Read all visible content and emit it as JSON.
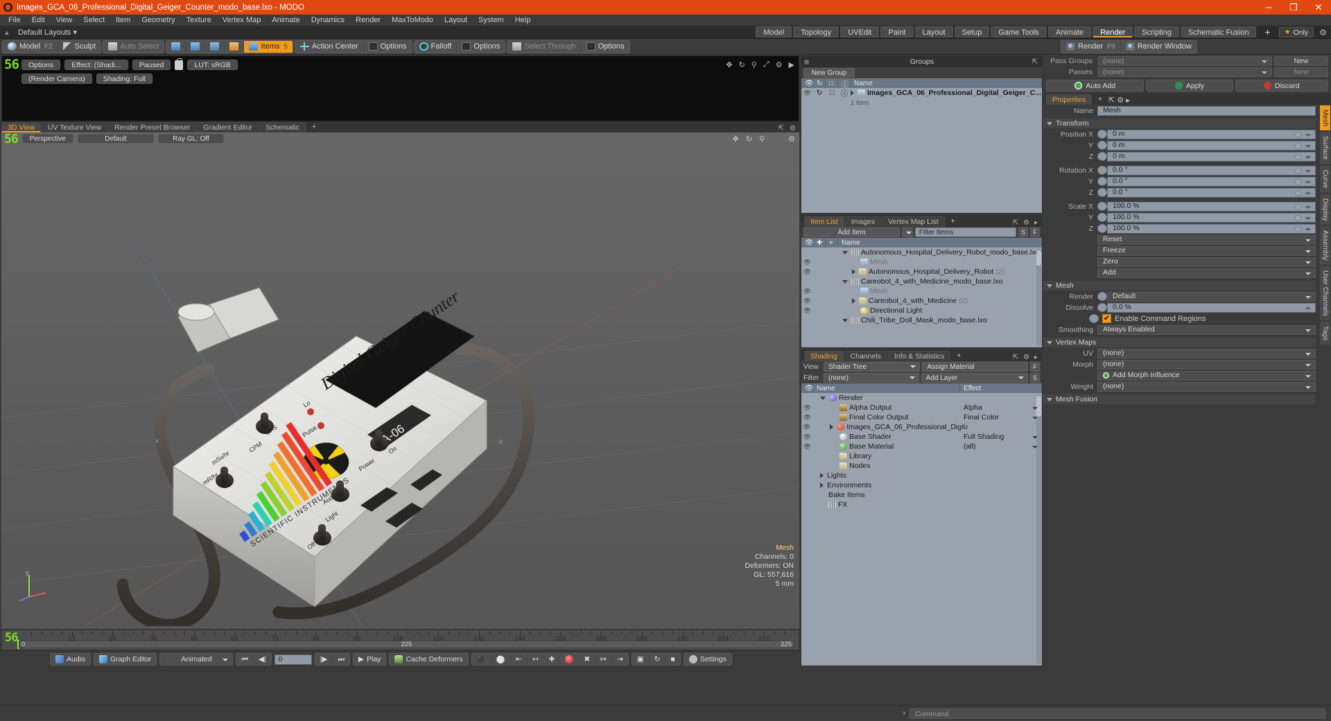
{
  "window": {
    "title": "Images_GCA_06_Professional_Digital_Geiger_Counter_modo_base.lxo - MODO",
    "minimize": "─",
    "maximize": "❐",
    "close": "✕"
  },
  "menu": [
    "File",
    "Edit",
    "View",
    "Select",
    "Item",
    "Geometry",
    "Texture",
    "Vertex Map",
    "Animate",
    "Dynamics",
    "Render",
    "MaxToModo",
    "Layout",
    "System",
    "Help"
  ],
  "layout_bar": {
    "default_layouts": "Default Layouts",
    "tabs": [
      "Model",
      "Topology",
      "UVEdit",
      "Paint",
      "Layout",
      "Setup",
      "Game Tools",
      "Animate",
      "Render",
      "Scripting",
      "Schematic Fusion"
    ],
    "active_tab": "Render",
    "add_tab": "+",
    "only_label": "Only"
  },
  "toolbar": {
    "group1": [
      {
        "label": "Model",
        "kb": "F2",
        "icon": "sphere-icon"
      },
      {
        "label": "Sculpt",
        "kb": "",
        "icon": "pencil-icon"
      }
    ],
    "group2": [
      {
        "label": "Auto Select",
        "kb": "",
        "icon": "cube-gray-icon",
        "dim": true
      }
    ],
    "group3": [
      {
        "label": "",
        "kb": "",
        "icon": "vertex-mode-icon"
      },
      {
        "label": "",
        "kb": "",
        "icon": "edge-mode-icon"
      },
      {
        "label": "",
        "kb": "",
        "icon": "polygon-mode-icon"
      },
      {
        "label": "",
        "kb": "",
        "icon": "material-mode-icon"
      },
      {
        "label": "Items",
        "kb": "5",
        "icon": "items-mode-icon",
        "active": true
      }
    ],
    "group4": [
      {
        "label": "Action Center",
        "kb": "",
        "icon": "action-center-icon"
      },
      {
        "label": "Options",
        "kb": "",
        "icon": "options-square-icon"
      }
    ],
    "group5": [
      {
        "label": "Falloff",
        "kb": "",
        "icon": "falloff-icon"
      },
      {
        "label": "Options",
        "kb": "",
        "icon": "options-square-icon"
      }
    ],
    "group6": [
      {
        "label": "Select Through",
        "kb": "",
        "icon": "select-through-icon",
        "dim": true
      },
      {
        "label": "Options",
        "kb": "",
        "icon": "options-square-icon"
      }
    ],
    "group7": [
      {
        "label": "Render",
        "kb": "F9",
        "icon": "render-icon"
      },
      {
        "label": "Render Window",
        "kb": "",
        "icon": "render-window-icon"
      }
    ]
  },
  "preview": {
    "badge": "56",
    "options": "Options",
    "effect": "Effect: (Shadi...",
    "paused": "Paused",
    "lut": "LUT: sRGB",
    "camera": "(Render Camera)",
    "shading": "Shading: Full",
    "icons": [
      "move-icon",
      "rotate-icon",
      "zoom-icon",
      "fit-icon",
      "gear-icon",
      "play-icon"
    ]
  },
  "viewport": {
    "tabs": [
      "3D View",
      "UV Texture View",
      "Render Preset Browser",
      "Gradient Editor",
      "Schematic"
    ],
    "active_tab": "3D View",
    "add_tab": "+",
    "badge": "56",
    "perspective": "Perspective",
    "shading_style": "Default",
    "raygl": "Ray GL: Off",
    "stats": {
      "title": "Mesh",
      "channels_label": "Channels:",
      "channels": "0",
      "deformers_label": "Deformers:",
      "deformers": "ON",
      "gl_label": "GL:",
      "gl": "557,616",
      "scale": "5 mm"
    },
    "axis_labels": {
      "x": "x",
      "y": "y",
      "z": "-z"
    },
    "device": {
      "title": "Digital Geiger Counter",
      "model": "A-06",
      "brand": "SCIENTIFIC INSTRUMENTS",
      "labels": [
        "Lo",
        "CPS",
        "Pulse",
        "CPM",
        "mSv/hr",
        "mR/hr",
        "Power",
        "On",
        "Audio",
        "Light",
        "Off"
      ]
    }
  },
  "timeline": {
    "badge": "56",
    "ticks": [
      12,
      24,
      36,
      48,
      60,
      72,
      84,
      96,
      108,
      120,
      132,
      144,
      156,
      168,
      180,
      192,
      204,
      216
    ],
    "start": "0",
    "mid": "225",
    "end": "225"
  },
  "bottombar": {
    "audio": "Audio",
    "graph_editor": "Graph Editor",
    "animated": "Animated",
    "frame_value": "0",
    "play": "Play",
    "cache_deformers": "Cache Deformers",
    "settings": "Settings"
  },
  "groups_panel": {
    "title": "Groups",
    "new_group": "New Group",
    "col_name": "Name",
    "item": {
      "name": "Images_GCA_06_Professional_Digital_Geiger_C...",
      "sub": "1 Item"
    }
  },
  "item_list": {
    "tabs": [
      "Item List",
      "Images",
      "Vertex Map List"
    ],
    "active_tab": "Item List",
    "add_tab": "+",
    "add_item": "Add Item",
    "filter_placeholder": "Filter Items",
    "btn_s": "S",
    "btn_f": "F",
    "col_name": "Name",
    "rows": [
      {
        "indent": 0,
        "twirl": "down",
        "icon": "film-icon",
        "name": "Autonomous_Hospital_Delivery_Robot_modo_base.lxo*",
        "eye": false,
        "dim": false
      },
      {
        "indent": 1,
        "twirl": "none",
        "icon": "cube-icon",
        "name": "Mesh",
        "eye": true,
        "dim": true
      },
      {
        "indent": 1,
        "twirl": "right",
        "icon": "folder-icon",
        "name": "Autonomous_Hospital_Delivery_Robot",
        "count": "(2)",
        "eye": true,
        "dim": false
      },
      {
        "indent": 0,
        "twirl": "down",
        "icon": "film-icon",
        "name": "Careobot_4_with_Medicine_modo_base.lxo",
        "eye": false,
        "dim": false
      },
      {
        "indent": 1,
        "twirl": "none",
        "icon": "cube-icon",
        "name": "Mesh",
        "eye": true,
        "dim": true
      },
      {
        "indent": 1,
        "twirl": "right",
        "icon": "folder-icon",
        "name": "Careobot_4_with_Medicine",
        "count": "(2)",
        "eye": true,
        "dim": false
      },
      {
        "indent": 1,
        "twirl": "none",
        "icon": "light-icon",
        "name": "Directional Light",
        "eye": true,
        "dim": false
      },
      {
        "indent": 0,
        "twirl": "down",
        "icon": "film-icon",
        "name": "Chili_Tribe_Doll_Mask_modo_base.lxo",
        "eye": false,
        "dim": false
      }
    ]
  },
  "shading_panel": {
    "tabs": [
      "Shading",
      "Channels",
      "Info & Statistics"
    ],
    "active_tab": "Shading",
    "add_tab": "+",
    "view_label": "View",
    "view_value": "Shader Tree",
    "assign_material": "Assign Material",
    "btn_f": "F",
    "filter_label": "Filter",
    "filter_value": "(none)",
    "add_layer": "Add Layer",
    "btn_s": "S",
    "col_name": "Name",
    "col_effect": "Effect",
    "rows": [
      {
        "indent": 0,
        "twirl": "down",
        "icon": "ball-purple-icon",
        "name": "Render",
        "effect": "",
        "eye": false
      },
      {
        "indent": 1,
        "twirl": "none",
        "icon": "image-icon",
        "name": "Alpha Output",
        "effect": "Alpha",
        "eye": true
      },
      {
        "indent": 1,
        "twirl": "none",
        "icon": "image-icon",
        "name": "Final Color Output",
        "effect": "Final Color",
        "eye": true
      },
      {
        "indent": 1,
        "twirl": "right",
        "icon": "ball-red-icon",
        "name": "Images_GCA_06_Professional_Digital_ ...",
        "effect": "",
        "eye": true
      },
      {
        "indent": 1,
        "twirl": "none",
        "icon": "ball-white-icon",
        "name": "Base Shader",
        "effect": "Full Shading",
        "eye": true
      },
      {
        "indent": 1,
        "twirl": "none",
        "icon": "ball-green-icon",
        "name": "Base Material",
        "effect": "(all)",
        "eye": true
      },
      {
        "indent": 1,
        "twirl": "none",
        "icon": "folder-icon",
        "name": "Library",
        "effect": "",
        "eye": false
      },
      {
        "indent": 1,
        "twirl": "none",
        "icon": "folder-icon",
        "name": "Nodes",
        "effect": "",
        "eye": false
      },
      {
        "indent": 0,
        "twirl": "right",
        "icon": "none",
        "name": "Lights",
        "effect": "",
        "eye": false
      },
      {
        "indent": 0,
        "twirl": "right",
        "icon": "none",
        "name": "Environments",
        "effect": "",
        "eye": false
      },
      {
        "indent": 0,
        "twirl": "none",
        "icon": "none",
        "name": "Bake Items",
        "effect": "",
        "eye": false
      },
      {
        "indent": 0,
        "twirl": "none",
        "icon": "film-icon",
        "name": "FX",
        "effect": "",
        "eye": false
      }
    ]
  },
  "passes": {
    "pass_groups_label": "Pass Groups",
    "pass_groups_value": "(none)",
    "pass_groups_new": "New",
    "passes_label": "Passes",
    "passes_value": "(none)",
    "passes_new": "New",
    "auto_add": "Auto Add",
    "apply": "Apply",
    "discard": "Discard"
  },
  "properties": {
    "tab": "Properties",
    "add_tab": "+",
    "name_label": "Name",
    "name_value": "Mesh",
    "transform_header": "Transform",
    "position": {
      "label": "Position X",
      "x": "0 m",
      "y": "0 m",
      "z": "0 m",
      "ylab": "Y",
      "zlab": "Z"
    },
    "rotation": {
      "label": "Rotation X",
      "x": "0.0 °",
      "y": "0.0 °",
      "z": "0.0 °",
      "ylab": "Y",
      "zlab": "Z"
    },
    "scale": {
      "label": "Scale X",
      "x": "100.0 %",
      "y": "100.0 %",
      "z": "100.0 %",
      "ylab": "Y",
      "zlab": "Z"
    },
    "actions": [
      "Reset",
      "Freeze",
      "Zero",
      "Add"
    ],
    "mesh_header": "Mesh",
    "render_label": "Render",
    "render_value": "Default",
    "dissolve_label": "Dissolve",
    "dissolve_value": "0.0 %",
    "enable_command_regions": "Enable Command Regions",
    "smoothing_label": "Smoothing",
    "smoothing_value": "Always Enabled",
    "vertex_maps_header": "Vertex Maps",
    "uv_label": "UV",
    "uv_value": "(none)",
    "morph_label": "Morph",
    "morph_value": "(none)",
    "add_morph_influence": "Add Morph Influence",
    "weight_label": "Weight",
    "weight_value": "(none)",
    "mesh_fusion_header": "Mesh Fusion",
    "vertical_tabs": [
      "Mesh",
      "Surface",
      "Curve",
      "Display",
      "Assembly",
      "User Channels",
      "Tags"
    ],
    "active_vertical_tab": "Mesh"
  },
  "command_bar": {
    "arrow": "›",
    "placeholder": "Command"
  },
  "colors": {
    "title_bar": "#e04a12",
    "accent": "#f2991f",
    "panel_bg": "#3b3b3b",
    "list_bg": "#9aa3ad",
    "field_blue": "#8f9aa6",
    "badge_green": "#7bdc24"
  }
}
